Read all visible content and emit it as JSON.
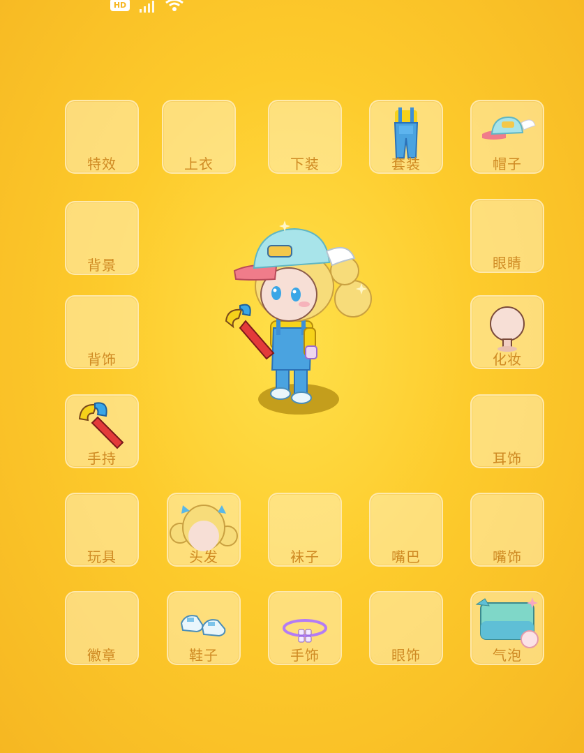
{
  "status_bar": {
    "hd_label": "HD",
    "icons": [
      "signal-icon",
      "wifi-icon"
    ]
  },
  "slots": {
    "texiao": {
      "label": "特效",
      "equipped": false
    },
    "shangyi": {
      "label": "上衣",
      "equipped": false
    },
    "xiazhuang": {
      "label": "下装",
      "equipped": false
    },
    "taozhuang": {
      "label": "套装",
      "equipped": true,
      "icon": "overalls-icon"
    },
    "maozi": {
      "label": "帽子",
      "equipped": true,
      "icon": "winged-cap-icon"
    },
    "beijing": {
      "label": "背景",
      "equipped": false
    },
    "yanjing": {
      "label": "眼睛",
      "equipped": false
    },
    "beishi": {
      "label": "背饰",
      "equipped": false
    },
    "huazhuang": {
      "label": "化妆",
      "equipped": true,
      "icon": "head-mannequin-icon"
    },
    "shouchi": {
      "label": "手持",
      "equipped": true,
      "icon": "wrench-icon"
    },
    "ershi": {
      "label": "耳饰",
      "equipped": false
    },
    "wanju": {
      "label": "玩具",
      "equipped": false
    },
    "toufa": {
      "label": "头发",
      "equipped": true,
      "icon": "blonde-hair-icon"
    },
    "wazi": {
      "label": "袜子",
      "equipped": false
    },
    "zuiba": {
      "label": "嘴巴",
      "equipped": false
    },
    "zuishi": {
      "label": "嘴饰",
      "equipped": false
    },
    "huizhang": {
      "label": "徽章",
      "equipped": false
    },
    "xiezi": {
      "label": "鞋子",
      "equipped": true,
      "icon": "sneakers-icon"
    },
    "shoushi": {
      "label": "手饰",
      "equipped": true,
      "icon": "bracelet-icon"
    },
    "yanshi": {
      "label": "眼饰",
      "equipped": false
    },
    "qipao": {
      "label": "气泡",
      "equipped": true,
      "icon": "chat-bubble-icon"
    }
  },
  "colors": {
    "background": "#fdcb2c",
    "slot_label": "#cf8a23",
    "overalls": "#4aa3e0",
    "cap": "#a8e4ea",
    "hair": "#f7dc7a"
  }
}
